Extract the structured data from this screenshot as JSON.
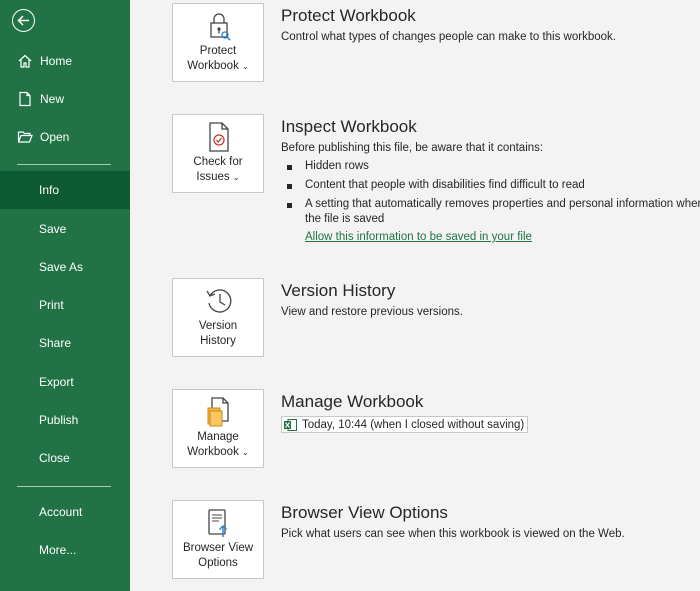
{
  "sidebar": {
    "back_icon": "back-arrow-icon",
    "items": [
      {
        "label": "Home",
        "icon": "home-icon"
      },
      {
        "label": "New",
        "icon": "new-document-icon"
      },
      {
        "label": "Open",
        "icon": "folder-open-icon"
      },
      {
        "label": "Info"
      },
      {
        "label": "Save"
      },
      {
        "label": "Save As"
      },
      {
        "label": "Print"
      },
      {
        "label": "Share"
      },
      {
        "label": "Export"
      },
      {
        "label": "Publish"
      },
      {
        "label": "Close"
      },
      {
        "label": "Account"
      },
      {
        "label": "More..."
      }
    ],
    "active": "Info"
  },
  "sections": {
    "protect": {
      "button_line1": "Protect",
      "button_line2": "Workbook",
      "title": "Protect Workbook",
      "description": "Control what types of changes people can make to this workbook."
    },
    "inspect": {
      "button_line1": "Check for",
      "button_line2": "Issues",
      "title": "Inspect Workbook",
      "description": "Before publishing this file, be aware that it contains:",
      "bullets": [
        "Hidden rows",
        "Content that people with disabilities find difficult to read",
        "A setting that automatically removes properties and personal information when",
        "the file is saved"
      ],
      "link": "Allow this information to be saved in your file"
    },
    "version": {
      "button_line1": "Version",
      "button_line2": "History",
      "title": "Version History",
      "description": "View and restore previous versions."
    },
    "manage": {
      "button_line1": "Manage",
      "button_line2": "Workbook",
      "title": "Manage Workbook",
      "autosave_entry": "Today, 10:44 (when I closed without saving)"
    },
    "browser": {
      "button_line1": "Browser View",
      "button_line2": "Options",
      "title": "Browser View Options",
      "description": "Pick what users can see when this workbook is viewed on the Web."
    }
  },
  "colors": {
    "sidebar_bg": "#217346",
    "sidebar_active": "#0e5a30",
    "link": "#217346",
    "page_bg": "#f3f3f3"
  }
}
